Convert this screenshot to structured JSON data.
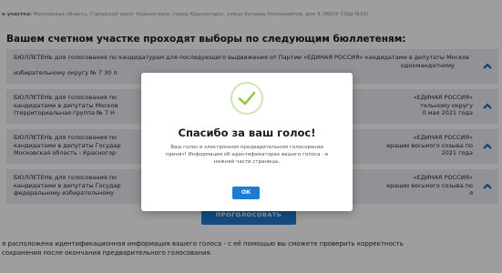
{
  "address": {
    "label": "н участка:",
    "value": "Московская область, Городской округ Красногорск, город Красногорск, улица Бульвар Космонавтов, дом 9 (МБОУ СОШ №18)"
  },
  "heading": "Вашем счетном участке проходят выборы по следующим бюллетеням:",
  "ballots": [
    {
      "text_visible": "БЮЛЛЕТЕНЬ для голосования по кандидатурам для последующего выдвижения от Партии «ЕДИНАЯ РОССИЯ» кандидатами в депутаты Москов",
      "text_visible_right": "одномандатному",
      "line2": "избирательному округу № 7 30 л"
    },
    {
      "line1_left": "БЮЛЛЕТЕНЬ для голосования по",
      "line1_right": "«ЕДИНАЯ РОССИЯ»",
      "line2_left": "кандидатами в депутаты Москов",
      "line2_right": "тельному округу",
      "line3_left": "(территориальная группа № 7 Н",
      "line3_right": "0 мая 2021 года"
    },
    {
      "line1_left": "БЮЛЛЕТЕНЬ для голосования по",
      "line1_right": "«ЕДИНАЯ РОССИЯ»",
      "line2_left": "кандидатами в депутаты Государ",
      "line2_right": "ерации восьмого созыва по",
      "line3_left": "Московская область - Красногор",
      "line3_right": "2021 года"
    },
    {
      "line1_left": "БЮЛЛЕТЕНЬ для голосования по",
      "line1_right": "«ЕДИНАЯ РОССИЯ»",
      "line2_left": "кандидатами в депутаты Государ",
      "line2_right": "ерации восьмого созыва по",
      "line3_left": "федеральному избирательному",
      "line3_right": "я"
    }
  ],
  "vote_button_label": "ПРОГОЛОСОВАТЬ",
  "footer": {
    "line1": "я расположена идентификационная информация вашего голоса - с её помощью вы сможете проверить корректность",
    "line2": "сохранения после окончания предварительного голосования."
  },
  "modal": {
    "title": "Спасибо за ваш голос!",
    "message": "Ваш голос в электронном предварительном голосовании принят! Информация об идентификаторах вашего голоса - в нижней части страницы.",
    "ok_label": "ОК"
  },
  "colors": {
    "accent": "#1d7bd1",
    "check": "#8cc63f",
    "ballot_bg": "#e8ecf1"
  },
  "icons": {
    "chevron": "chevron-up-icon",
    "success": "check-circle-icon"
  }
}
